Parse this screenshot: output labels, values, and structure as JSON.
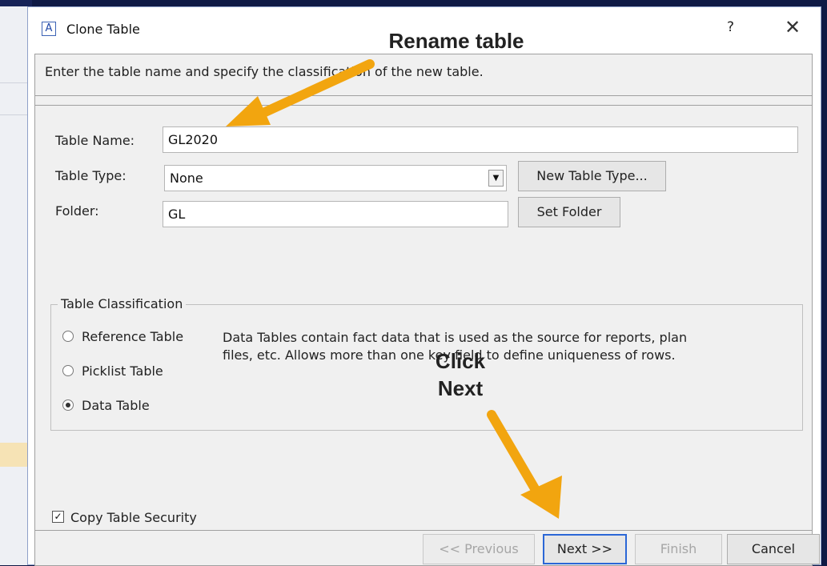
{
  "dialog": {
    "app_icon_letter": "A",
    "title": "Clone Table",
    "help_label": "?",
    "close_label": "✕"
  },
  "instruction": "Enter the table name and specify the classification of the new table.",
  "form": {
    "table_name_label": "Table Name:",
    "table_name_value": "GL2020",
    "table_type_label": "Table Type:",
    "table_type_value": "None",
    "new_table_type_label": "New Table Type...",
    "folder_label": "Folder:",
    "folder_value": "GL",
    "set_folder_label": "Set Folder"
  },
  "classification": {
    "group_title": "Table Classification",
    "options": [
      {
        "label": "Reference Table",
        "selected": false
      },
      {
        "label": "Picklist Table",
        "selected": false
      },
      {
        "label": "Data Table",
        "selected": true
      }
    ],
    "description_line1": "Data Tables contain fact data that is used as the source for reports, plan",
    "description_line2": "files, etc.  Allows more than one key field to define uniqueness of rows."
  },
  "copy_security": {
    "label": "Copy Table Security",
    "checked": true
  },
  "footer_buttons": {
    "previous": "<< Previous",
    "next": "Next >>",
    "finish": "Finish",
    "cancel": "Cancel"
  },
  "annotations": {
    "rename": "Rename table",
    "click_line1": "Click",
    "click_line2": "Next",
    "arrow_color": "#f2a50f"
  }
}
